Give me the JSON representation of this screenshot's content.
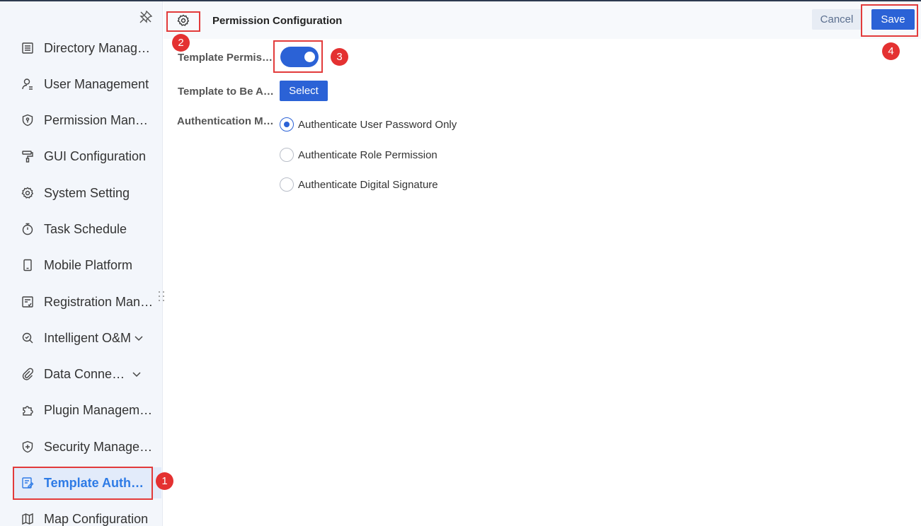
{
  "sidebar": {
    "items": [
      {
        "label": "Directory Management",
        "icon": "directory-icon"
      },
      {
        "label": "User Management",
        "icon": "user-icon"
      },
      {
        "label": "Permission Management",
        "icon": "permission-shield-icon"
      },
      {
        "label": "GUI Configuration",
        "icon": "paint-roller-icon"
      },
      {
        "label": "System Setting",
        "icon": "gear-icon"
      },
      {
        "label": "Task Schedule",
        "icon": "stopwatch-icon"
      },
      {
        "label": "Mobile Platform",
        "icon": "mobile-icon"
      },
      {
        "label": "Registration Management",
        "icon": "registration-icon"
      },
      {
        "label": "Intelligent O&M",
        "icon": "intelligent-om-icon",
        "expandable": true
      },
      {
        "label": "Data Connection",
        "icon": "paperclip-icon",
        "expandable": true
      },
      {
        "label": "Plugin Management",
        "icon": "puzzle-icon"
      },
      {
        "label": "Security Management",
        "icon": "security-shield-icon"
      },
      {
        "label": "Template Authentication",
        "icon": "template-edit-icon",
        "active": true
      },
      {
        "label": "Map Configuration",
        "icon": "map-icon"
      }
    ]
  },
  "header": {
    "title": "Permission Configuration",
    "cancel_label": "Cancel",
    "save_label": "Save"
  },
  "form": {
    "template_permission_label": "Template Permission",
    "template_permission_enabled": true,
    "template_to_be_label": "Template to Be Authenticated",
    "select_label": "Select",
    "auth_method_label": "Authentication Method",
    "auth_options": [
      {
        "label": "Authenticate User Password Only",
        "checked": true
      },
      {
        "label": "Authenticate Role Permission",
        "checked": false
      },
      {
        "label": "Authenticate Digital Signature",
        "checked": false
      }
    ]
  },
  "annotations": [
    "1",
    "2",
    "3",
    "4"
  ],
  "colors": {
    "accent": "#2b62d6",
    "active_nav_text": "#2e7be6",
    "annotation_red": "#e43131"
  }
}
